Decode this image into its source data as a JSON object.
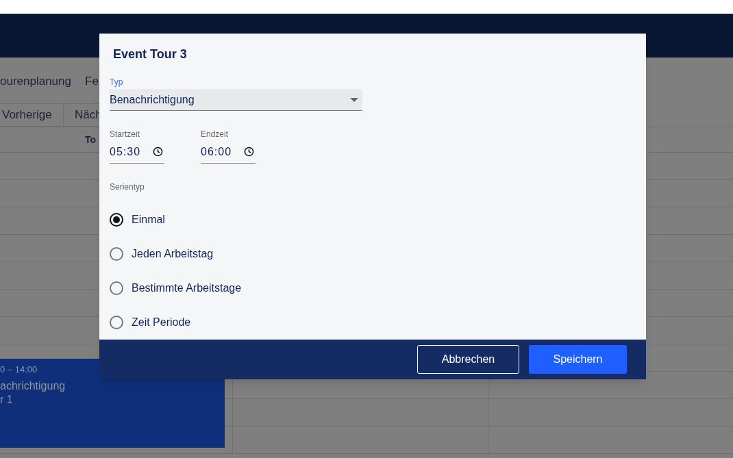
{
  "app": {
    "nav_items": [
      "ourenplanung",
      "Fe"
    ],
    "buttons": [
      "Vorherige",
      "Näch"
    ],
    "column_header": "To",
    "event": {
      "time": "0 – 14:00",
      "title": "achrichtigung",
      "subtitle": "r 1"
    }
  },
  "dialog": {
    "title": "Event Tour 3",
    "type_field": {
      "label": "Typ",
      "value": "Benachrichtigung"
    },
    "start_time": {
      "label": "Startzeit",
      "value": "05:30"
    },
    "end_time": {
      "label": "Endzeit",
      "value": "06:00"
    },
    "series_label": "Serientyp",
    "series_options": [
      {
        "label": "Einmal",
        "selected": true
      },
      {
        "label": "Jeden Arbeitstag",
        "selected": false
      },
      {
        "label": "Bestimmte Arbeitstage",
        "selected": false
      },
      {
        "label": "Zeit Periode",
        "selected": false
      }
    ],
    "buttons": [
      {
        "label": "Abbrechen",
        "kind": "secondary"
      },
      {
        "label": "Speichern",
        "kind": "primary"
      }
    ]
  }
}
